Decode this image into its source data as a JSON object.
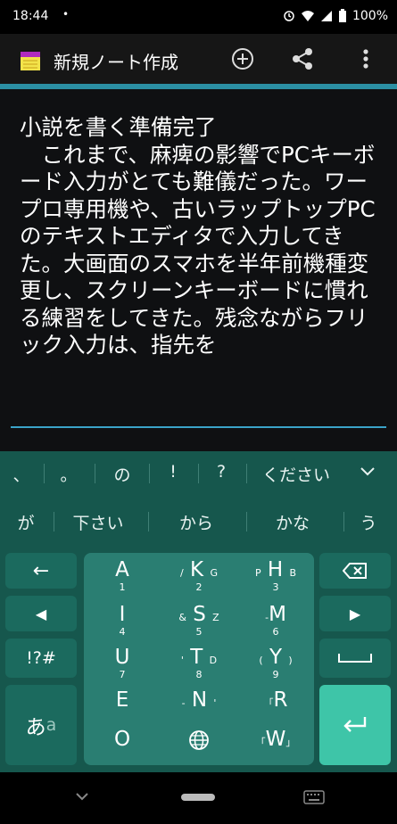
{
  "status": {
    "time": "18:44",
    "dot": "•",
    "battery": "100%"
  },
  "app_bar": {
    "title": "新規ノート作成",
    "icons": [
      "note-icon",
      "add-circle-icon",
      "share-icon",
      "more-vert-icon"
    ]
  },
  "editor": {
    "text": "小説を書く準備完了\n　これまで、麻痺の影響でPCキーボード入力がとても難儀だった。ワープロ専用機や、古いラップトップPCのテキストエディタで入力してきた。大画面のスマホを半年前機種変更し、スクリーンキーボードに慣れる練習をしてきた。残念ながらフリック入力は、指先を"
  },
  "keyboard": {
    "suggestions_row1": [
      "、",
      "。",
      "の",
      "!",
      "?",
      "ください"
    ],
    "suggestions_row2": [
      "が",
      "下さい",
      "から",
      "かな",
      "う"
    ],
    "left_keys": {
      "backspace_arrow": "←",
      "left": "◀",
      "symbols": "!?#",
      "mode_main": "あ",
      "mode_sub": "a"
    },
    "right_keys": {
      "delete": "⌫",
      "right": "▶",
      "space": "⎵",
      "enter": "↵"
    },
    "center_keys": [
      {
        "big": "A",
        "sub": "1"
      },
      {
        "big": "K",
        "top": "@",
        "left": "/",
        "right": "G",
        "sub": "2"
      },
      {
        "big": "H",
        "left": "P",
        "right": "B",
        "sub": "3"
      },
      {
        "big": "I",
        "sub": "4"
      },
      {
        "big": "S",
        "left": "&",
        "right": "Z",
        "sub": "5"
      },
      {
        "big": "M",
        "left": "-",
        "sub": "6"
      },
      {
        "big": "U",
        "sub": "7"
      },
      {
        "big": "T",
        "left": "'",
        "right": "D",
        "sub": "8"
      },
      {
        "big": "Y",
        "left": "(",
        "right": ")",
        "sub": "9"
      },
      {
        "big": "E",
        "sub": ""
      },
      {
        "big": "N",
        "left": "-",
        "right": "'",
        "sub": ""
      },
      {
        "big": "R",
        "top": "「",
        "sub": ""
      },
      {
        "big": "O",
        "sub": ""
      },
      {
        "big": "🌐",
        "sub": ""
      },
      {
        "big": "W",
        "left": "「",
        "right": "」",
        "sub": ""
      }
    ]
  }
}
